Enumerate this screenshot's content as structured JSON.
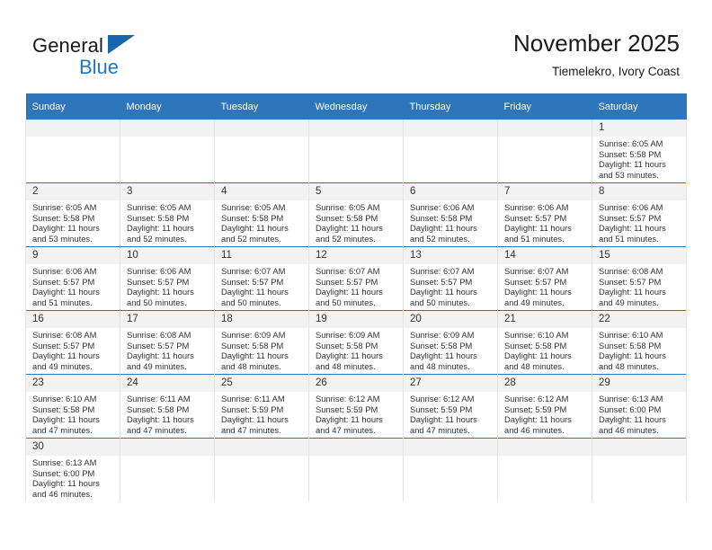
{
  "brand": {
    "name_top": "General",
    "name_bottom": "Blue",
    "flag_icon": "blue-triangle-flag",
    "colors": {
      "dark_text": "#1a1a1a",
      "blue_text": "#1b79c4",
      "flag": "#1566ad"
    }
  },
  "header": {
    "title": "November 2025",
    "subtitle": "Tiemelekro, Ivory Coast"
  },
  "calendar": {
    "header_bg": "#2e76bc",
    "daynum_bg": "#f2f2f2",
    "weekday_headers": [
      "Sunday",
      "Monday",
      "Tuesday",
      "Wednesday",
      "Thursday",
      "Friday",
      "Saturday"
    ],
    "weeks": [
      [
        {
          "day": "",
          "lines": []
        },
        {
          "day": "",
          "lines": []
        },
        {
          "day": "",
          "lines": []
        },
        {
          "day": "",
          "lines": []
        },
        {
          "day": "",
          "lines": []
        },
        {
          "day": "",
          "lines": []
        },
        {
          "day": "1",
          "lines": [
            "Sunrise: 6:05 AM",
            "Sunset: 5:58 PM",
            "Daylight: 11 hours",
            "and 53 minutes."
          ]
        }
      ],
      [
        {
          "day": "2",
          "lines": [
            "Sunrise: 6:05 AM",
            "Sunset: 5:58 PM",
            "Daylight: 11 hours",
            "and 53 minutes."
          ]
        },
        {
          "day": "3",
          "lines": [
            "Sunrise: 6:05 AM",
            "Sunset: 5:58 PM",
            "Daylight: 11 hours",
            "and 52 minutes."
          ]
        },
        {
          "day": "4",
          "lines": [
            "Sunrise: 6:05 AM",
            "Sunset: 5:58 PM",
            "Daylight: 11 hours",
            "and 52 minutes."
          ]
        },
        {
          "day": "5",
          "lines": [
            "Sunrise: 6:05 AM",
            "Sunset: 5:58 PM",
            "Daylight: 11 hours",
            "and 52 minutes."
          ]
        },
        {
          "day": "6",
          "lines": [
            "Sunrise: 6:06 AM",
            "Sunset: 5:58 PM",
            "Daylight: 11 hours",
            "and 52 minutes."
          ]
        },
        {
          "day": "7",
          "lines": [
            "Sunrise: 6:06 AM",
            "Sunset: 5:57 PM",
            "Daylight: 11 hours",
            "and 51 minutes."
          ]
        },
        {
          "day": "8",
          "lines": [
            "Sunrise: 6:06 AM",
            "Sunset: 5:57 PM",
            "Daylight: 11 hours",
            "and 51 minutes."
          ]
        }
      ],
      [
        {
          "day": "9",
          "lines": [
            "Sunrise: 6:06 AM",
            "Sunset: 5:57 PM",
            "Daylight: 11 hours",
            "and 51 minutes."
          ]
        },
        {
          "day": "10",
          "lines": [
            "Sunrise: 6:06 AM",
            "Sunset: 5:57 PM",
            "Daylight: 11 hours",
            "and 50 minutes."
          ]
        },
        {
          "day": "11",
          "lines": [
            "Sunrise: 6:07 AM",
            "Sunset: 5:57 PM",
            "Daylight: 11 hours",
            "and 50 minutes."
          ]
        },
        {
          "day": "12",
          "lines": [
            "Sunrise: 6:07 AM",
            "Sunset: 5:57 PM",
            "Daylight: 11 hours",
            "and 50 minutes."
          ]
        },
        {
          "day": "13",
          "lines": [
            "Sunrise: 6:07 AM",
            "Sunset: 5:57 PM",
            "Daylight: 11 hours",
            "and 50 minutes."
          ]
        },
        {
          "day": "14",
          "lines": [
            "Sunrise: 6:07 AM",
            "Sunset: 5:57 PM",
            "Daylight: 11 hours",
            "and 49 minutes."
          ]
        },
        {
          "day": "15",
          "lines": [
            "Sunrise: 6:08 AM",
            "Sunset: 5:57 PM",
            "Daylight: 11 hours",
            "and 49 minutes."
          ]
        }
      ],
      [
        {
          "day": "16",
          "lines": [
            "Sunrise: 6:08 AM",
            "Sunset: 5:57 PM",
            "Daylight: 11 hours",
            "and 49 minutes."
          ]
        },
        {
          "day": "17",
          "lines": [
            "Sunrise: 6:08 AM",
            "Sunset: 5:57 PM",
            "Daylight: 11 hours",
            "and 49 minutes."
          ]
        },
        {
          "day": "18",
          "lines": [
            "Sunrise: 6:09 AM",
            "Sunset: 5:58 PM",
            "Daylight: 11 hours",
            "and 48 minutes."
          ]
        },
        {
          "day": "19",
          "lines": [
            "Sunrise: 6:09 AM",
            "Sunset: 5:58 PM",
            "Daylight: 11 hours",
            "and 48 minutes."
          ]
        },
        {
          "day": "20",
          "lines": [
            "Sunrise: 6:09 AM",
            "Sunset: 5:58 PM",
            "Daylight: 11 hours",
            "and 48 minutes."
          ]
        },
        {
          "day": "21",
          "lines": [
            "Sunrise: 6:10 AM",
            "Sunset: 5:58 PM",
            "Daylight: 11 hours",
            "and 48 minutes."
          ]
        },
        {
          "day": "22",
          "lines": [
            "Sunrise: 6:10 AM",
            "Sunset: 5:58 PM",
            "Daylight: 11 hours",
            "and 48 minutes."
          ]
        }
      ],
      [
        {
          "day": "23",
          "lines": [
            "Sunrise: 6:10 AM",
            "Sunset: 5:58 PM",
            "Daylight: 11 hours",
            "and 47 minutes."
          ]
        },
        {
          "day": "24",
          "lines": [
            "Sunrise: 6:11 AM",
            "Sunset: 5:58 PM",
            "Daylight: 11 hours",
            "and 47 minutes."
          ]
        },
        {
          "day": "25",
          "lines": [
            "Sunrise: 6:11 AM",
            "Sunset: 5:59 PM",
            "Daylight: 11 hours",
            "and 47 minutes."
          ]
        },
        {
          "day": "26",
          "lines": [
            "Sunrise: 6:12 AM",
            "Sunset: 5:59 PM",
            "Daylight: 11 hours",
            "and 47 minutes."
          ]
        },
        {
          "day": "27",
          "lines": [
            "Sunrise: 6:12 AM",
            "Sunset: 5:59 PM",
            "Daylight: 11 hours",
            "and 47 minutes."
          ]
        },
        {
          "day": "28",
          "lines": [
            "Sunrise: 6:12 AM",
            "Sunset: 5:59 PM",
            "Daylight: 11 hours",
            "and 46 minutes."
          ]
        },
        {
          "day": "29",
          "lines": [
            "Sunrise: 6:13 AM",
            "Sunset: 6:00 PM",
            "Daylight: 11 hours",
            "and 46 minutes."
          ]
        }
      ],
      [
        {
          "day": "30",
          "lines": [
            "Sunrise: 6:13 AM",
            "Sunset: 6:00 PM",
            "Daylight: 11 hours",
            "and 46 minutes."
          ]
        },
        {
          "day": "",
          "lines": []
        },
        {
          "day": "",
          "lines": []
        },
        {
          "day": "",
          "lines": []
        },
        {
          "day": "",
          "lines": []
        },
        {
          "day": "",
          "lines": []
        },
        {
          "day": "",
          "lines": []
        }
      ]
    ]
  }
}
